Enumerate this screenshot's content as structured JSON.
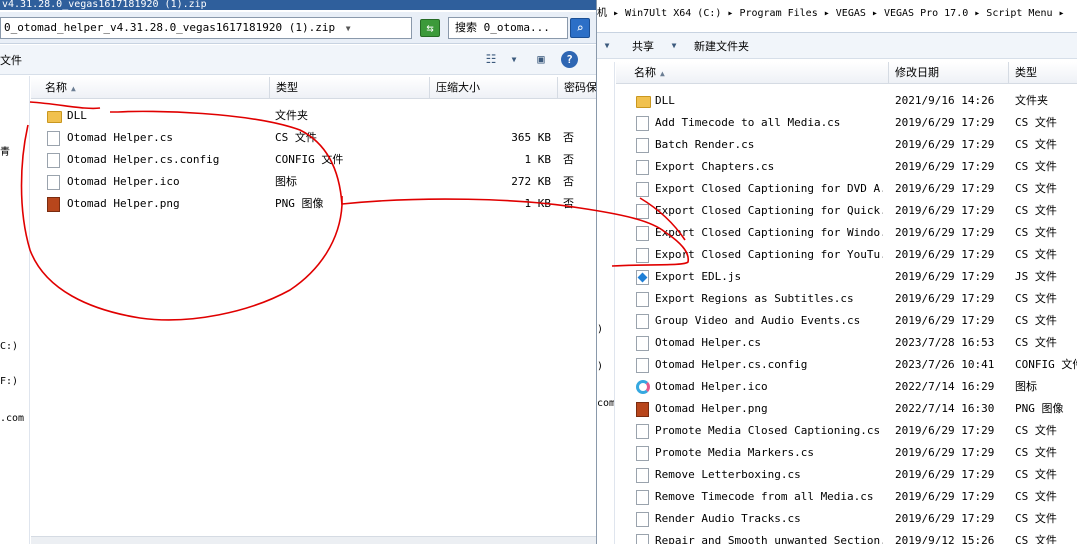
{
  "left_window": {
    "title": "v4.31.28.0_vegas1617181920 (1).zip",
    "address": "0_otomad_helper_v4.31.28.0_vegas1617181920 (1).zip",
    "search_placeholder": "搜索 0_otoma...",
    "toolbar_partial": "文件",
    "nav_fragments": [
      "青",
      "C:)",
      "F:)",
      ".com"
    ],
    "columns": [
      "名称",
      "类型",
      "压缩大小",
      "密码保"
    ],
    "rows": [
      {
        "name": "DLL",
        "type": "文件夹",
        "size": "",
        "pwd": "",
        "icon": "folder-icon"
      },
      {
        "name": "Otomad Helper.cs",
        "type": "CS 文件",
        "size": "365 KB",
        "pwd": "否",
        "icon": "file-icon"
      },
      {
        "name": "Otomad Helper.cs.config",
        "type": "CONFIG 文件",
        "size": "1 KB",
        "pwd": "否",
        "icon": "file-icon"
      },
      {
        "name": "Otomad Helper.ico",
        "type": "图标",
        "size": "272 KB",
        "pwd": "否",
        "icon": "file-icon"
      },
      {
        "name": "Otomad Helper.png",
        "type": "PNG 图像",
        "size": "1 KB",
        "pwd": "否",
        "icon": "image-icon"
      }
    ]
  },
  "right_window": {
    "address": "机 ▸ Win7Ult X64 (C:) ▸ Program Files ▸ VEGAS ▸ VEGAS Pro 17.0 ▸ Script Menu ▸",
    "toolbar": {
      "share": "共享",
      "new_folder": "新建文件夹"
    },
    "nav_fragments": [
      ")",
      ")",
      "com"
    ],
    "columns": [
      "名称",
      "修改日期",
      "类型"
    ],
    "rows": [
      {
        "name": "DLL",
        "date": "2021/9/16 14:26",
        "type": "文件夹",
        "icon": "folder-icon"
      },
      {
        "name": "Add Timecode to all Media.cs",
        "date": "2019/6/29 17:29",
        "type": "CS 文件",
        "icon": "file-icon"
      },
      {
        "name": "Batch Render.cs",
        "date": "2019/6/29 17:29",
        "type": "CS 文件",
        "icon": "file-icon"
      },
      {
        "name": "Export Chapters.cs",
        "date": "2019/6/29 17:29",
        "type": "CS 文件",
        "icon": "file-icon"
      },
      {
        "name": "Export Closed Captioning for DVD A...",
        "date": "2019/6/29 17:29",
        "type": "CS 文件",
        "icon": "file-icon"
      },
      {
        "name": "Export Closed Captioning for Quick...",
        "date": "2019/6/29 17:29",
        "type": "CS 文件",
        "icon": "file-icon"
      },
      {
        "name": "Export Closed Captioning for Windo...",
        "date": "2019/6/29 17:29",
        "type": "CS 文件",
        "icon": "file-icon"
      },
      {
        "name": "Export Closed Captioning for YouTu...",
        "date": "2019/6/29 17:29",
        "type": "CS 文件",
        "icon": "file-icon"
      },
      {
        "name": "Export EDL.js",
        "date": "2019/6/29 17:29",
        "type": "JS 文件",
        "icon": "js-file-icon"
      },
      {
        "name": "Export Regions as Subtitles.cs",
        "date": "2019/6/29 17:29",
        "type": "CS 文件",
        "icon": "file-icon"
      },
      {
        "name": "Group Video and Audio Events.cs",
        "date": "2019/6/29 17:29",
        "type": "CS 文件",
        "icon": "file-icon"
      },
      {
        "name": "Otomad Helper.cs",
        "date": "2023/7/28 16:53",
        "type": "CS 文件",
        "icon": "file-icon"
      },
      {
        "name": "Otomad Helper.cs.config",
        "date": "2023/7/26 10:41",
        "type": "CONFIG 文件",
        "icon": "file-icon"
      },
      {
        "name": "Otomad Helper.ico",
        "date": "2022/7/14 16:29",
        "type": "图标",
        "icon": "ring-icon"
      },
      {
        "name": "Otomad Helper.png",
        "date": "2022/7/14 16:30",
        "type": "PNG 图像",
        "icon": "image-icon"
      },
      {
        "name": "Promote Media Closed Captioning.cs",
        "date": "2019/6/29 17:29",
        "type": "CS 文件",
        "icon": "file-icon"
      },
      {
        "name": "Promote Media Markers.cs",
        "date": "2019/6/29 17:29",
        "type": "CS 文件",
        "icon": "file-icon"
      },
      {
        "name": "Remove Letterboxing.cs",
        "date": "2019/6/29 17:29",
        "type": "CS 文件",
        "icon": "file-icon"
      },
      {
        "name": "Remove Timecode from all Media.cs",
        "date": "2019/6/29 17:29",
        "type": "CS 文件",
        "icon": "file-icon"
      },
      {
        "name": "Render Audio Tracks.cs",
        "date": "2019/6/29 17:29",
        "type": "CS 文件",
        "icon": "file-icon"
      },
      {
        "name": "Repair and Smooth unwanted Section.cs",
        "date": "2019/9/12 15:26",
        "type": "CS 文件",
        "icon": "file-icon"
      }
    ]
  },
  "colors": {
    "annotation": "#e00000",
    "titlebar": "#2f5f9c",
    "addressbar": "#e9eff7"
  }
}
